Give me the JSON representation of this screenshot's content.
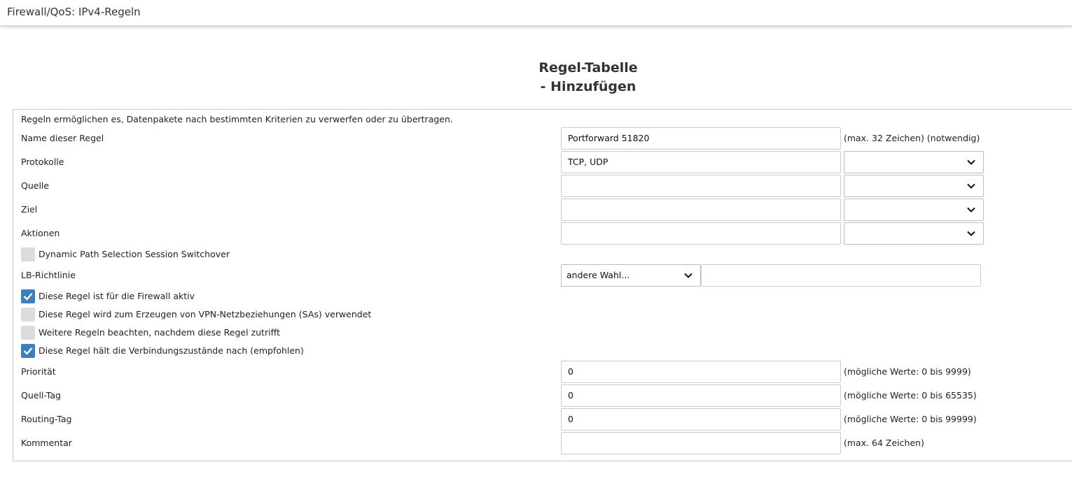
{
  "header": {
    "title": "Firewall/QoS: IPv4-Regeln"
  },
  "heading": {
    "line1": "Regel-Tabelle",
    "line2": "- Hinzufügen"
  },
  "form": {
    "intro": "Regeln ermöglichen es, Datenpakete nach bestimmten Kriterien zu verwerfen oder zu übertragen.",
    "name": {
      "label": "Name dieser Regel",
      "value": "Portforward 51820",
      "hint": "(max. 32 Zeichen) (notwendig)"
    },
    "protokolle": {
      "label": "Protokolle",
      "value": "TCP, UDP",
      "select_value": ""
    },
    "quelle": {
      "label": "Quelle",
      "value": "",
      "select_value": ""
    },
    "ziel": {
      "label": "Ziel",
      "value": "",
      "select_value": ""
    },
    "aktionen": {
      "label": "Aktionen",
      "value": "",
      "select_value": ""
    },
    "dynamic_path": {
      "label": "Dynamic Path Selection Session Switchover",
      "checked": false
    },
    "lb_richtlinie": {
      "label": "LB-Richtlinie",
      "select_value": "andere Wahl...",
      "value": ""
    },
    "firewall_aktiv": {
      "label": "Diese Regel ist für die Firewall aktiv",
      "checked": true
    },
    "vpn_sas": {
      "label": "Diese Regel wird zum Erzeugen von VPN-Netzbeziehungen (SAs) verwendet",
      "checked": false
    },
    "weitere_regeln": {
      "label": "Weitere Regeln beachten, nachdem diese Regel zutrifft",
      "checked": false
    },
    "verbindungszustaende": {
      "label": "Diese Regel hält die Verbindungszustände nach (empfohlen)",
      "checked": true
    },
    "prioritaet": {
      "label": "Priorität",
      "value": "0",
      "hint": "(mögliche Werte: 0 bis 9999)"
    },
    "quell_tag": {
      "label": "Quell-Tag",
      "value": "0",
      "hint": "(mögliche Werte: 0 bis 65535)"
    },
    "routing_tag": {
      "label": "Routing-Tag",
      "value": "0",
      "hint": "(mögliche Werte: 0 bis 99999)"
    },
    "kommentar": {
      "label": "Kommentar",
      "value": "",
      "hint": "(max. 64 Zeichen)"
    }
  },
  "icons": {
    "chevron": "chevron-down-icon",
    "check": "checkmark-icon"
  },
  "colors": {
    "checkbox_checked": "#3d7ebf",
    "checkbox_unchecked": "#dcdcdc",
    "input_border": "#cccccc"
  }
}
